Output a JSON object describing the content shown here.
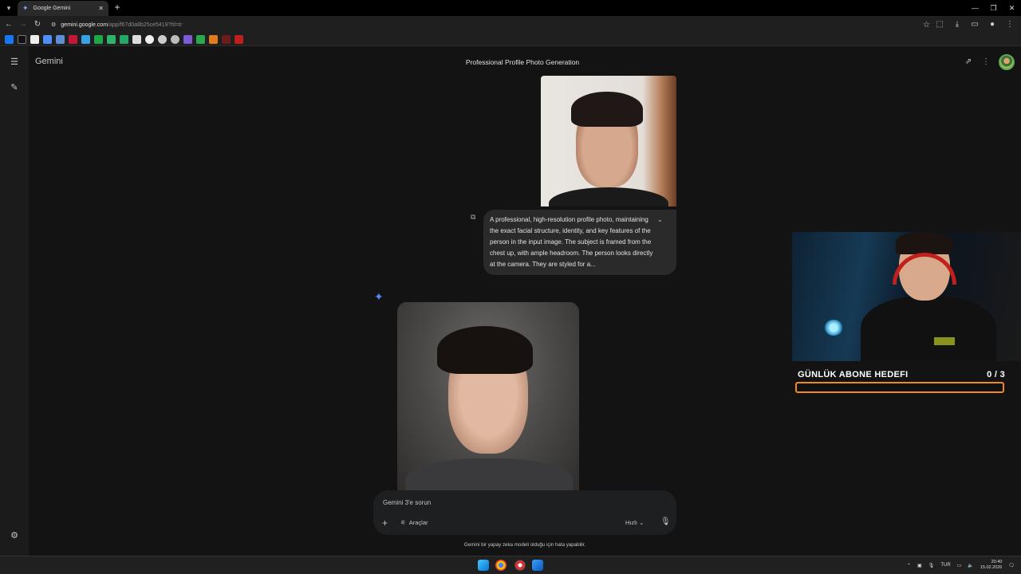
{
  "browser": {
    "tab_title": "Google Gemini",
    "url_host": "gemini.google.com",
    "url_path": "/app/f67d0a8b25ce5419?hl=tr"
  },
  "app": {
    "brand": "Gemini",
    "conversation_title": "Professional Profile Photo Generation"
  },
  "chat": {
    "prompt_text": "A professional, high-resolution profile photo, maintaining the exact facial structure, identity, and key features of the person in the input image. The subject is framed from the chest up, with ample headroom. The person looks directly at the camera. They are styled for a..."
  },
  "input": {
    "placeholder": "Gemini 3'e sorun",
    "tools_label": "Araçlar",
    "mode_label": "Hızlı",
    "disclaimer": "Gemini bir yapay zeka modeli olduğu için hata yapabilir."
  },
  "overlay": {
    "goal_label": "GÜNLÜK ABONE HEDEFI",
    "goal_value": "0  / 3",
    "goal_progress": 0
  },
  "taskbar": {
    "lang": "TUR",
    "time": "20:40",
    "date": "15.02.2026"
  },
  "colors": {
    "accent": "#4f8df9",
    "goal_orange": "#f08a1c",
    "background": "#131314"
  }
}
